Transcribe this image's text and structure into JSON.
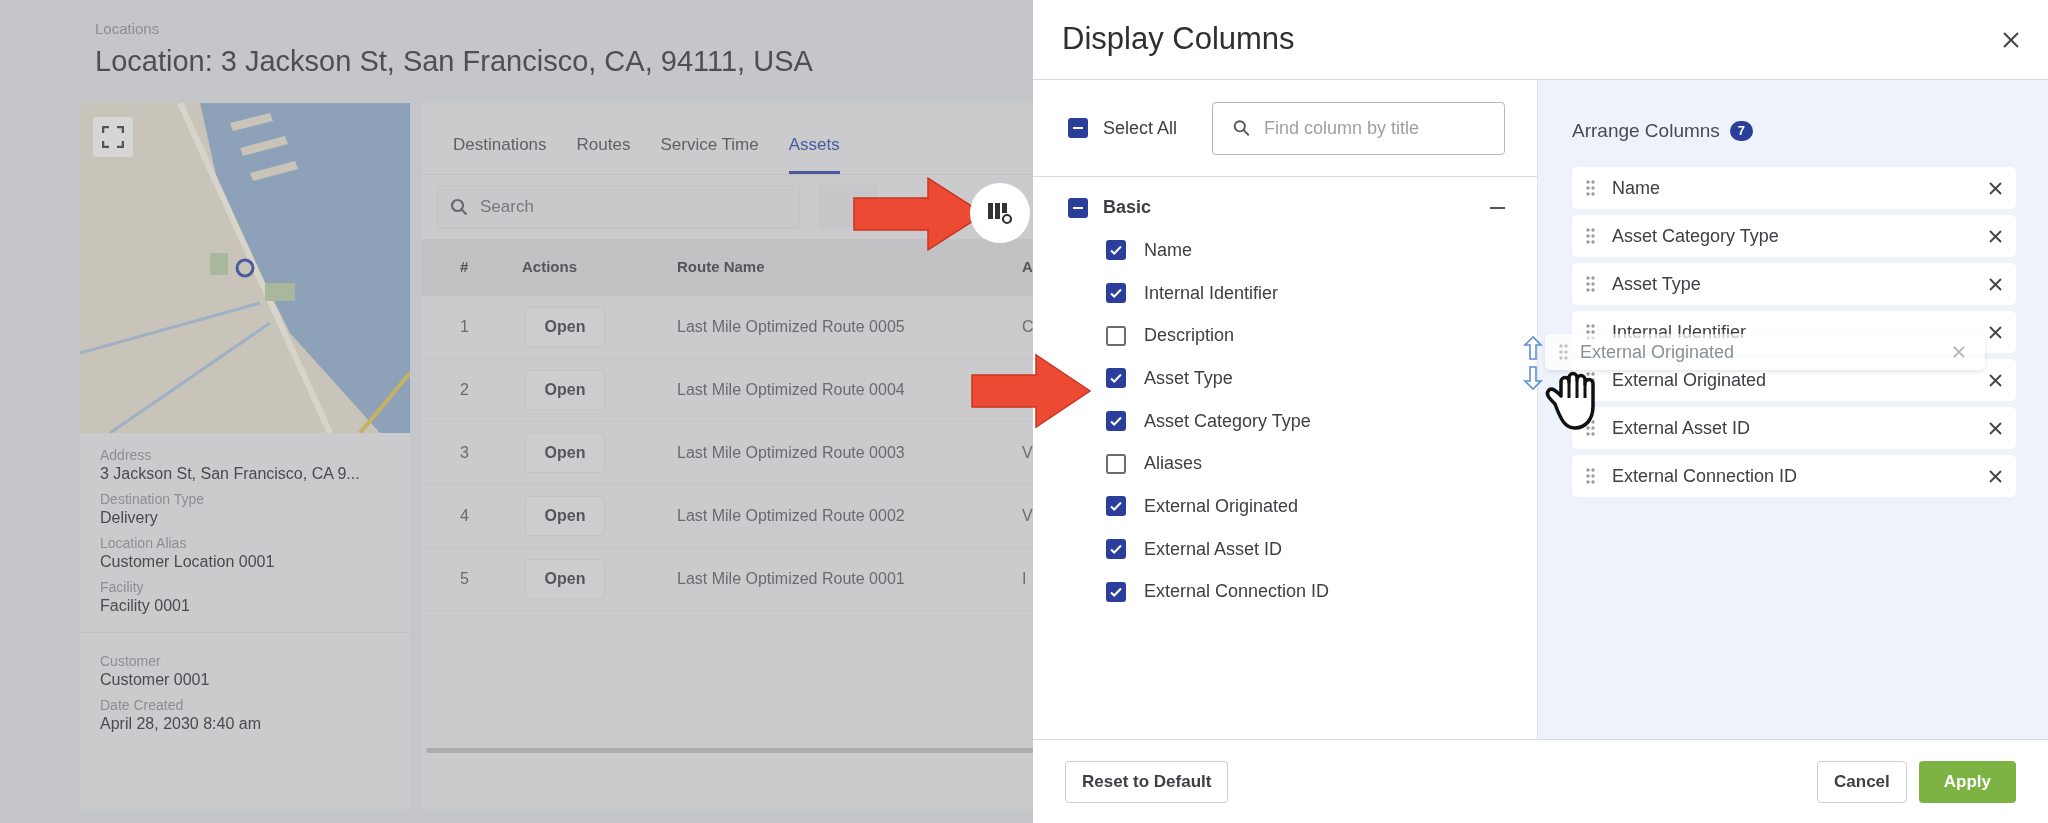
{
  "page": {
    "breadcrumb": "Locations",
    "title": "Location: 3 Jackson St, San Francisco, CA, 94111, USA",
    "detail_groups": [
      [
        {
          "label": "Address",
          "value": "3 Jackson St, San Francisco, CA 9..."
        },
        {
          "label": "Destination Type",
          "value": "Delivery"
        },
        {
          "label": "Location Alias",
          "value": "Customer Location 0001"
        },
        {
          "label": "Facility",
          "value": "Facility 0001"
        }
      ],
      [
        {
          "label": "Customer",
          "value": "Customer 0001"
        },
        {
          "label": "Date Created",
          "value": "April 28, 2030 8:40 am"
        }
      ]
    ],
    "tabs": [
      {
        "label": "Destinations",
        "selected": false
      },
      {
        "label": "Routes",
        "selected": false
      },
      {
        "label": "Service Time",
        "selected": false
      },
      {
        "label": "Assets",
        "selected": true
      }
    ],
    "search": {
      "placeholder": "Search"
    },
    "table": {
      "columns": [
        "#",
        "Actions",
        "Route Name",
        "A"
      ],
      "rows": [
        {
          "number": "1",
          "action": "Open",
          "route_name": "Last Mile Optimized Route 0005",
          "column_4": "C"
        },
        {
          "number": "2",
          "action": "Open",
          "route_name": "Last Mile Optimized Route 0004"
        },
        {
          "number": "3",
          "action": "Open",
          "route_name": "Last Mile Optimized Route 0003",
          "column_4": "V"
        },
        {
          "number": "4",
          "action": "Open",
          "route_name": "Last Mile Optimized Route 0002",
          "column_4": "V"
        },
        {
          "number": "5",
          "action": "Open",
          "route_name": "Last Mile Optimized Route 0001",
          "column_4": "I"
        }
      ]
    }
  },
  "dialog": {
    "title": "Display Columns",
    "select_all": {
      "label": "Select All",
      "indeterminate": true
    },
    "search": {
      "placeholder": "Find column by title"
    },
    "group": {
      "label": "Basic",
      "indeterminate": true,
      "expanded": true,
      "items": [
        {
          "label": "Name",
          "checked": true
        },
        {
          "label": "Internal Identifier",
          "checked": true
        },
        {
          "label": "Description",
          "checked": false
        },
        {
          "label": "Asset Type",
          "checked": true
        },
        {
          "label": "Asset Category Type",
          "checked": true
        },
        {
          "label": "Aliases",
          "checked": false
        },
        {
          "label": "External Originated",
          "checked": true
        },
        {
          "label": "External Asset ID",
          "checked": true
        },
        {
          "label": "External Connection ID",
          "checked": true
        }
      ]
    },
    "arrange": {
      "title": "Arrange Columns",
      "count": "7",
      "items": [
        "Name",
        "Asset Category Type",
        "Asset Type",
        "Internal Identifier",
        "External Originated",
        "External Asset ID",
        "External Connection ID"
      ]
    },
    "dragging": {
      "label": "External Originated"
    },
    "buttons": {
      "reset": "Reset to Default",
      "cancel": "Cancel",
      "apply": "Apply"
    }
  }
}
